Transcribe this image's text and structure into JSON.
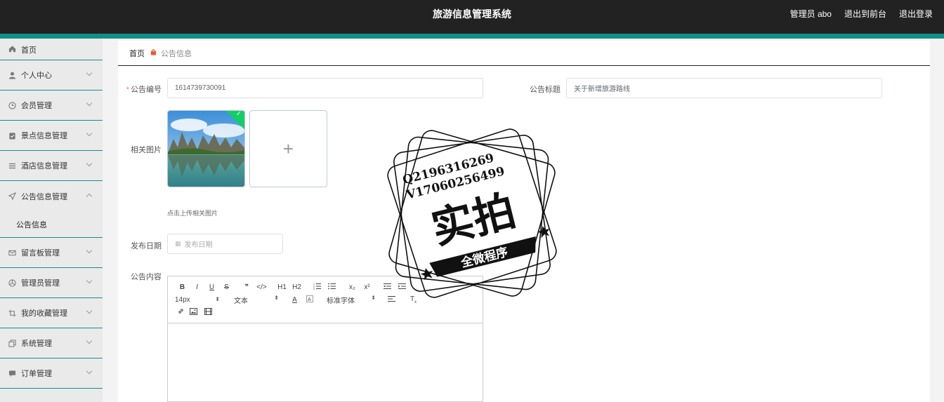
{
  "header": {
    "title": "旅游信息管理系统",
    "admin_label": "管理员 abo",
    "back_to_front": "退出到前台",
    "logout": "退出登录"
  },
  "sidebar": {
    "items": [
      {
        "label": "首页",
        "icon": "home-icon"
      },
      {
        "label": "个人中心",
        "icon": "user-icon"
      },
      {
        "label": "会员管理",
        "icon": "clock-icon"
      },
      {
        "label": "景点信息管理",
        "icon": "clipboard-icon"
      },
      {
        "label": "酒店信息管理",
        "icon": "list-icon"
      },
      {
        "label": "公告信息管理",
        "icon": "send-icon"
      },
      {
        "label": "留言板管理",
        "icon": "mail-icon"
      },
      {
        "label": "管理员管理",
        "icon": "aperture-icon"
      },
      {
        "label": "我的收藏管理",
        "icon": "crop-icon"
      },
      {
        "label": "系统管理",
        "icon": "copy-icon"
      },
      {
        "label": "订单管理",
        "icon": "chat-icon"
      }
    ],
    "submenu_active": "公告信息"
  },
  "breadcrumb": {
    "home": "首页",
    "current": "公告信息"
  },
  "form": {
    "notice_no_label": "公告编号",
    "notice_no_value": "1614739730091",
    "notice_title_label": "公告标题",
    "notice_title_value": "关于新增旅游路线",
    "image_label": "相关图片",
    "upload_tip": "点击上传相关图片",
    "date_label": "发布日期",
    "date_placeholder": "发布日期",
    "content_label": "公告内容"
  },
  "editor": {
    "font_size": "14px",
    "text_type": "文本",
    "font_family": "标准字体",
    "buttons_row1": [
      "B",
      "I",
      "U",
      "S",
      "❞",
      "</>",
      "H1",
      "H2",
      "OL",
      "UL",
      "x₂",
      "x²",
      "⇤",
      "⇥"
    ]
  },
  "watermark": {
    "line1": "Q2196316269",
    "line2": "V17060256499",
    "big_text": "实拍",
    "banner": "全微程序"
  },
  "colors": {
    "topbar": "#222222",
    "accent": "#128f8a",
    "required": "#f56c6c"
  }
}
